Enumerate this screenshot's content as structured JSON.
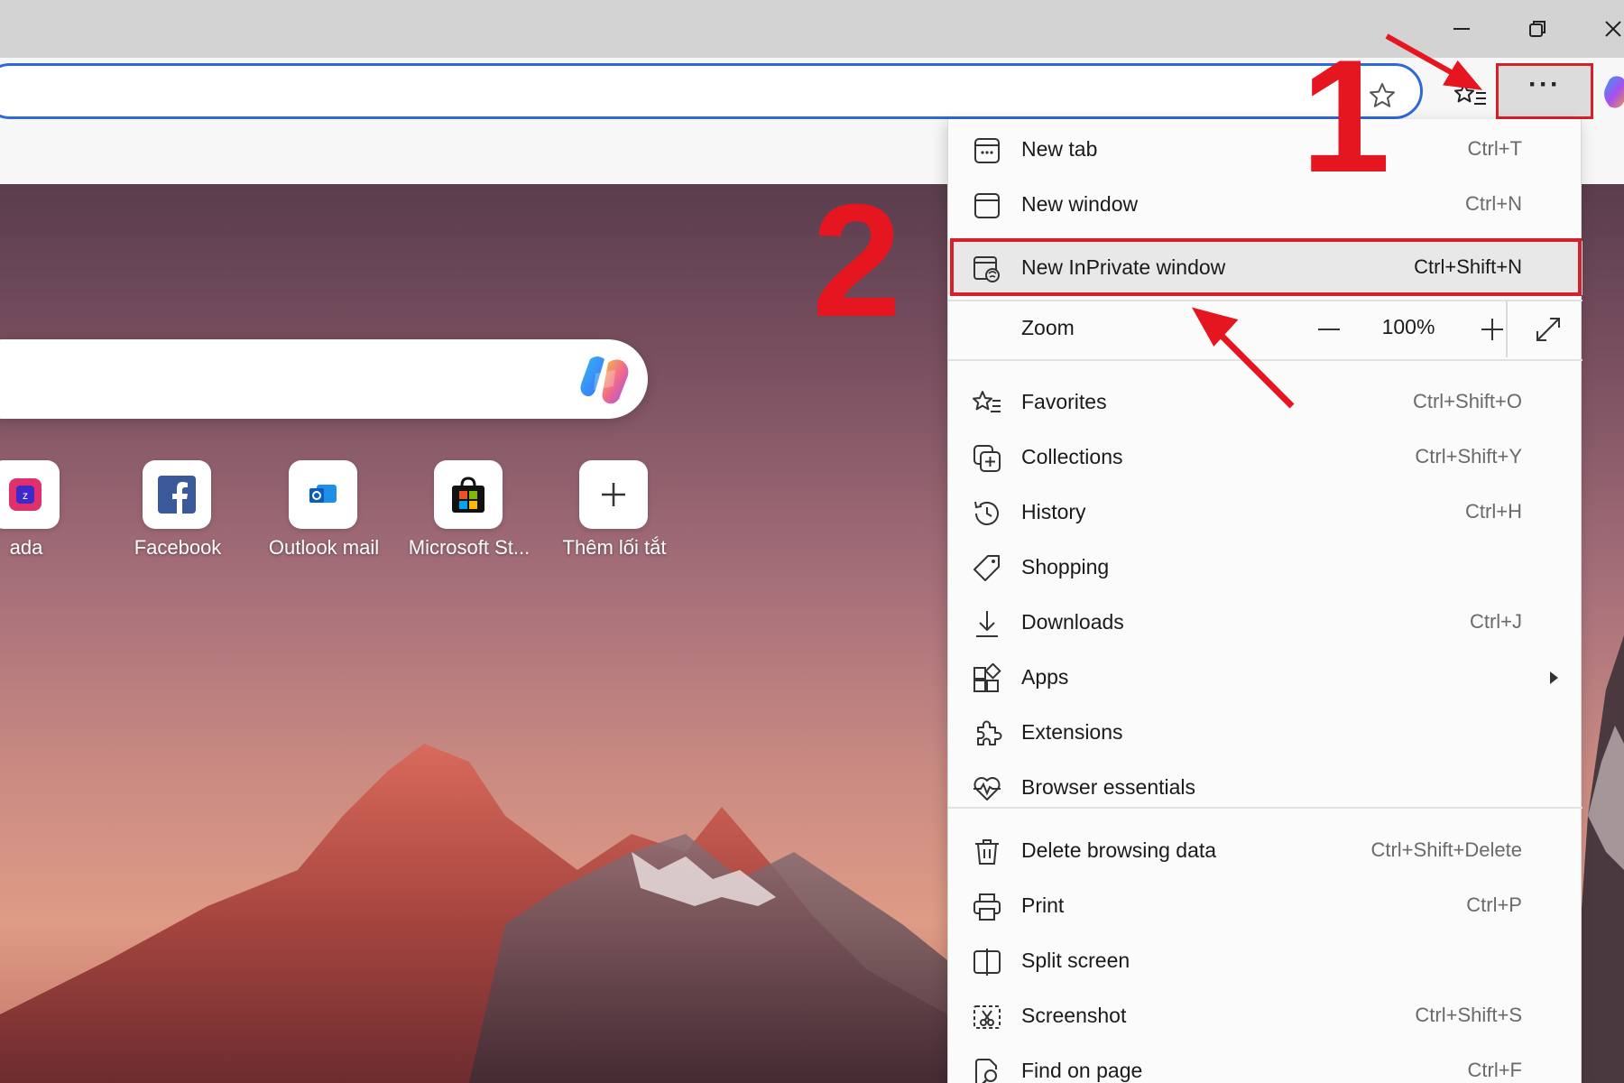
{
  "window_controls": {
    "minimize_icon": "minimize-icon",
    "restore_icon": "restore-icon",
    "close_icon": "close-icon"
  },
  "tiles": [
    {
      "label": "ada",
      "icon": "lazada-icon"
    },
    {
      "label": "Facebook",
      "icon": "facebook-icon"
    },
    {
      "label": "Outlook mail",
      "icon": "outlook-icon"
    },
    {
      "label": "Microsoft St...",
      "icon": "microsoft-store-icon"
    },
    {
      "label": "Thêm lối tắt",
      "icon": "plus-icon"
    }
  ],
  "menu": {
    "items": [
      {
        "label": "New tab",
        "shortcut": "Ctrl+T",
        "icon": "new-tab-icon"
      },
      {
        "label": "New window",
        "shortcut": "Ctrl+N",
        "icon": "new-window-icon"
      },
      {
        "label": "New InPrivate window",
        "shortcut": "Ctrl+Shift+N",
        "icon": "inprivate-icon"
      },
      {
        "label": "Favorites",
        "shortcut": "Ctrl+Shift+O",
        "icon": "favorites-icon"
      },
      {
        "label": "Collections",
        "shortcut": "Ctrl+Shift+Y",
        "icon": "collections-icon"
      },
      {
        "label": "History",
        "shortcut": "Ctrl+H",
        "icon": "history-icon"
      },
      {
        "label": "Shopping",
        "shortcut": "",
        "icon": "shopping-tag-icon"
      },
      {
        "label": "Downloads",
        "shortcut": "Ctrl+J",
        "icon": "download-icon"
      },
      {
        "label": "Apps",
        "shortcut": "",
        "icon": "apps-icon"
      },
      {
        "label": "Extensions",
        "shortcut": "",
        "icon": "extensions-icon"
      },
      {
        "label": "Browser essentials",
        "shortcut": "",
        "icon": "heart-pulse-icon"
      },
      {
        "label": "Delete browsing data",
        "shortcut": "Ctrl+Shift+Delete",
        "icon": "trash-icon"
      },
      {
        "label": "Print",
        "shortcut": "Ctrl+P",
        "icon": "print-icon"
      },
      {
        "label": "Split screen",
        "shortcut": "",
        "icon": "split-screen-icon"
      },
      {
        "label": "Screenshot",
        "shortcut": "Ctrl+Shift+S",
        "icon": "screenshot-icon"
      },
      {
        "label": "Find on page",
        "shortcut": "Ctrl+F",
        "icon": "find-icon"
      }
    ],
    "zoom": {
      "label": "Zoom",
      "value": "100%",
      "minus": "—",
      "plus": "+"
    }
  },
  "toolbar": {
    "more_label": "···"
  },
  "annotations": {
    "step1": "1",
    "step2": "2"
  },
  "colors": {
    "accent_red": "#d4212b",
    "address_border": "#2f68d9"
  }
}
